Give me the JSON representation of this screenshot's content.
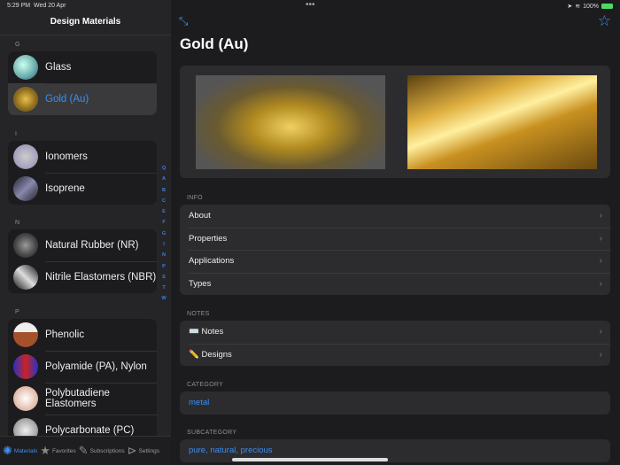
{
  "status": {
    "time": "5:29 PM",
    "date": "Wed 20 Apr",
    "battery": "100%"
  },
  "sidebar": {
    "title": "Design Materials",
    "sections": [
      {
        "letter": "G",
        "items": [
          {
            "label": "Glass"
          },
          {
            "label": "Gold (Au)",
            "selected": true
          }
        ]
      },
      {
        "letter": "I",
        "items": [
          {
            "label": "Ionomers"
          },
          {
            "label": "Isoprene"
          }
        ]
      },
      {
        "letter": "N",
        "items": [
          {
            "label": "Natural Rubber (NR)"
          },
          {
            "label": "Nitrile Elastomers (NBR)"
          }
        ]
      },
      {
        "letter": "P",
        "items": [
          {
            "label": "Phenolic"
          },
          {
            "label": "Polyamide (PA), Nylon"
          },
          {
            "label": "Polybutadiene Elastomers"
          },
          {
            "label": "Polycarbonate (PC)"
          }
        ]
      }
    ],
    "index": [
      "Q",
      "A",
      "B",
      "C",
      "E",
      "F",
      "G",
      "I",
      "N",
      "P",
      "S",
      "T",
      "W"
    ]
  },
  "tabs": [
    {
      "label": "Materials",
      "icon": "aperture-icon"
    },
    {
      "label": "Favorites",
      "icon": "star-icon"
    },
    {
      "label": "Subscriptions",
      "icon": "compose-icon"
    },
    {
      "label": "Settings",
      "icon": "play-circle-icon"
    }
  ],
  "detail": {
    "title": "Gold (Au)",
    "info_header": "INFO",
    "info": [
      "About",
      "Properties",
      "Applications",
      "Types"
    ],
    "notes_header": "NOTES",
    "notes": [
      "⌨️ Notes",
      "✏️ Designs"
    ],
    "category_header": "CATEGORY",
    "category": "metal",
    "subcategory_header": "SUBCATEGORY",
    "subcategory": "pure, natural, precious"
  },
  "colors": {
    "accent": "#3d8ef0"
  }
}
